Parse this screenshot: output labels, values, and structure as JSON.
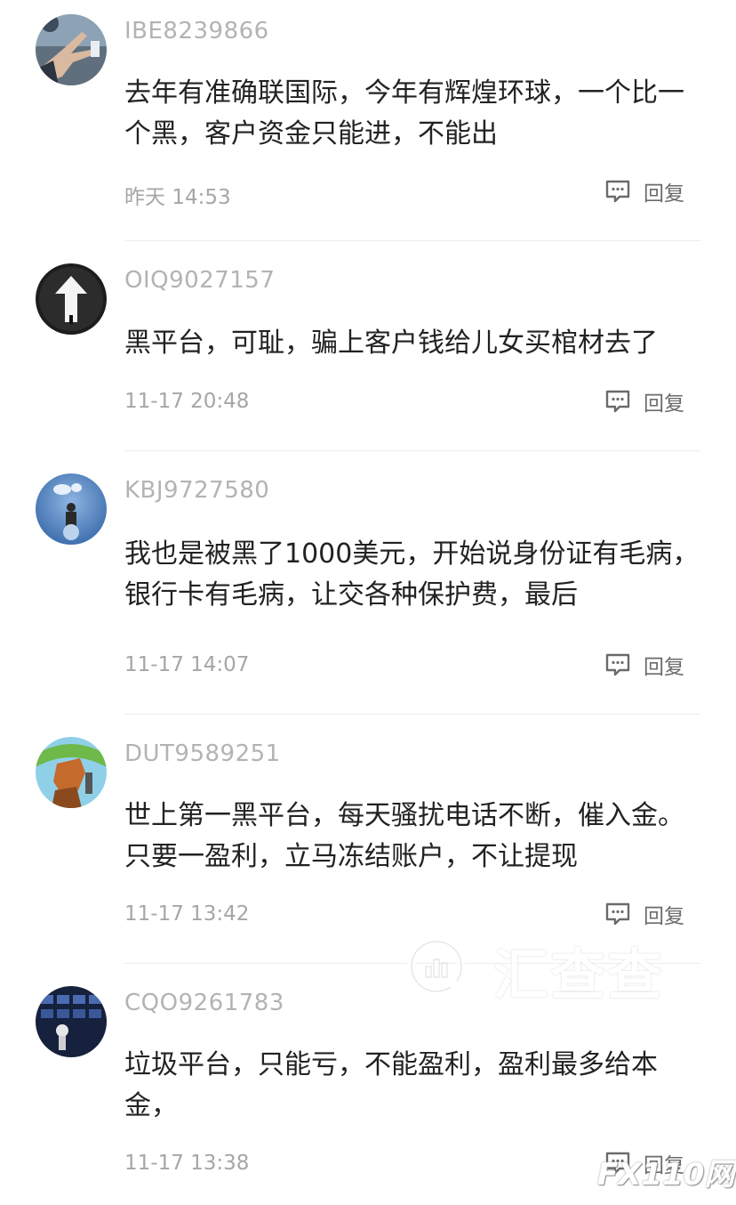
{
  "reply_label": "回复",
  "comments": [
    {
      "username": "IBE8239866",
      "content": "去年有准确联国际，今年有辉煌环球，一个比一个黑，客户资金只能进，不能出",
      "time": "昨天 14:53"
    },
    {
      "username": "OIQ9027157",
      "content": "黑平台，可耻，骗上客户钱给儿女买棺材去了",
      "time": "11-17 20:48"
    },
    {
      "username": "KBJ9727580",
      "content": "我也是被黑了1000美元，开始说身份证有毛病，银行卡有毛病，让交各种保护费，最后",
      "time": "11-17 14:07"
    },
    {
      "username": "DUT9589251",
      "content": "世上第一黑平台，每天骚扰电话不断，催入金。只要一盈利，立马冻结账户，不让提现",
      "time": "11-17 13:42"
    },
    {
      "username": "CQO9261783",
      "content": "垃圾平台，只能亏，不能盈利，盈利最多给本金，",
      "time": "11-17 13:38"
    }
  ],
  "watermark": {
    "brand": "汇查查",
    "corner": "FX110网"
  },
  "colors": {
    "username": "#b3b3b3",
    "content": "#222222",
    "time": "#a6a6a6",
    "divider": "#ececec"
  }
}
